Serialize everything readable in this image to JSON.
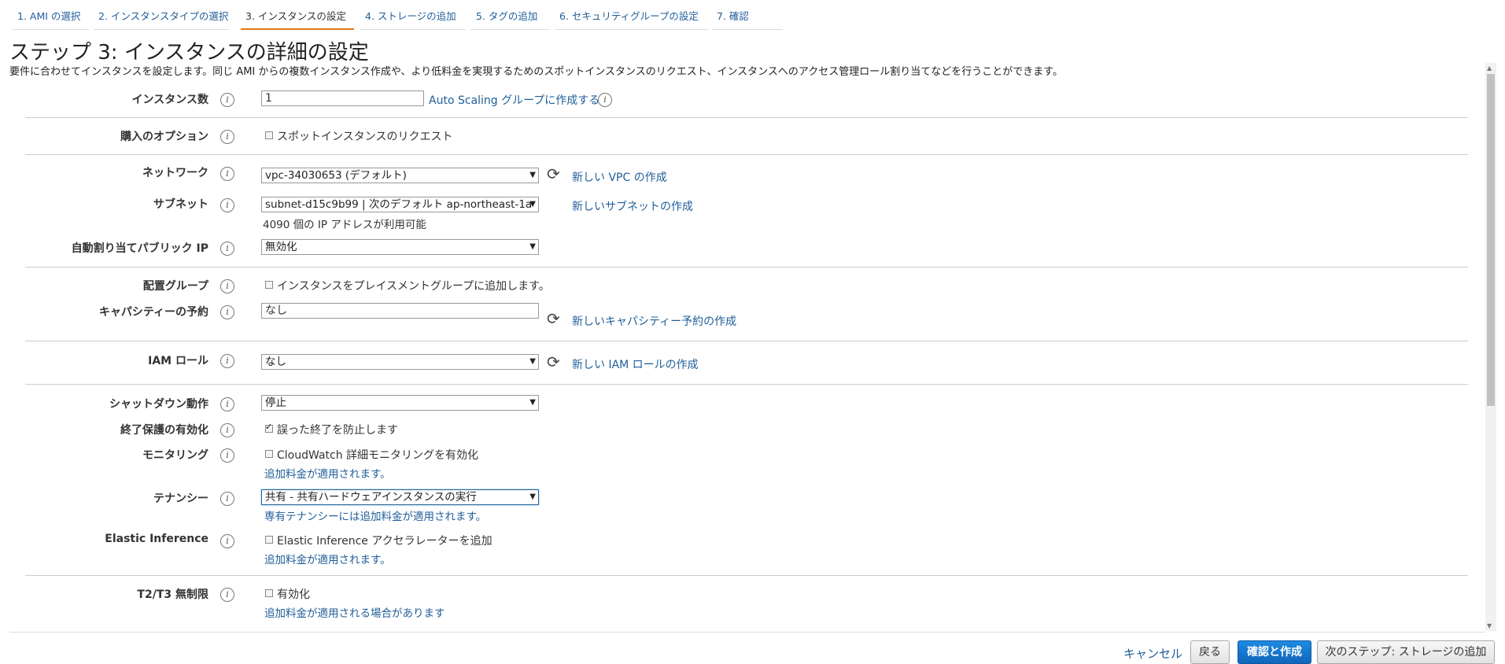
{
  "steps": [
    {
      "label": "1. AMI の選択"
    },
    {
      "label": "2. インスタンスタイプの選択"
    },
    {
      "label": "3. インスタンスの設定"
    },
    {
      "label": "4. ストレージの追加"
    },
    {
      "label": "5. タグの追加"
    },
    {
      "label": "6. セキュリティグループの設定"
    },
    {
      "label": "7. 確認"
    }
  ],
  "page": {
    "title": "ステップ 3: インスタンスの詳細の設定",
    "subtitle": "要件に合わせてインスタンスを設定します。同じ AMI からの複数インスタンス作成や、より低料金を実現するためのスポットインスタンスのリクエスト、インスタンスへのアクセス管理ロール割り当てなどを行うことができます。"
  },
  "info_glyph": "i",
  "refresh_glyph": "⟳",
  "select_arrow": "▼",
  "form": {
    "instance_count": {
      "label": "インスタンス数",
      "value": "1",
      "link": "Auto Scaling グループに作成する"
    },
    "purchase_option": {
      "label": "購入のオプション",
      "checkbox": "スポットインスタンスのリクエスト",
      "checked": false
    },
    "network": {
      "label": "ネットワーク",
      "value": "vpc-34030653 (デフォルト)",
      "link": "新しい VPC の作成"
    },
    "subnet": {
      "label": "サブネット",
      "value": "subnet-d15c9b99 | 次のデフォルト ap-northeast-1a",
      "note": "4090 個の IP アドレスが利用可能",
      "link": "新しいサブネットの作成"
    },
    "public_ip": {
      "label": "自動割り当てパブリック IP",
      "value": "無効化"
    },
    "placement_group": {
      "label": "配置グループ",
      "checkbox": "インスタンスをプレイスメントグループに追加します。",
      "checked": false
    },
    "capacity_reservation": {
      "label": "キャパシティーの予約",
      "value": "なし",
      "link": "新しいキャパシティー予約の作成"
    },
    "iam_role": {
      "label": "IAM ロール",
      "value": "なし",
      "link": "新しい IAM ロールの作成"
    },
    "shutdown": {
      "label": "シャットダウン動作",
      "value": "停止"
    },
    "termination_protection": {
      "label": "終了保護の有効化",
      "checkbox": "誤った終了を防止します",
      "checked": true
    },
    "monitoring": {
      "label": "モニタリング",
      "checkbox": "CloudWatch 詳細モニタリングを有効化",
      "checked": false,
      "link": "追加料金が適用されます。"
    },
    "tenancy": {
      "label": "テナンシー",
      "value": "共有 - 共有ハードウェアインスタンスの実行",
      "link": "専有テナンシーには追加料金が適用されます。"
    },
    "elastic_inference": {
      "label": "Elastic Inference",
      "checkbox": "Elastic Inference アクセラレーターを追加",
      "checked": false,
      "link": "追加料金が適用されます。"
    },
    "t2t3_unlimited": {
      "label": "T2/T3 無制限",
      "checkbox": "有効化",
      "checked": false,
      "link": "追加料金が適用される場合があります"
    }
  },
  "footer": {
    "cancel": "キャンセル",
    "back": "戻る",
    "review_launch": "確認と作成",
    "next": "次のステップ: ストレージの追加"
  }
}
